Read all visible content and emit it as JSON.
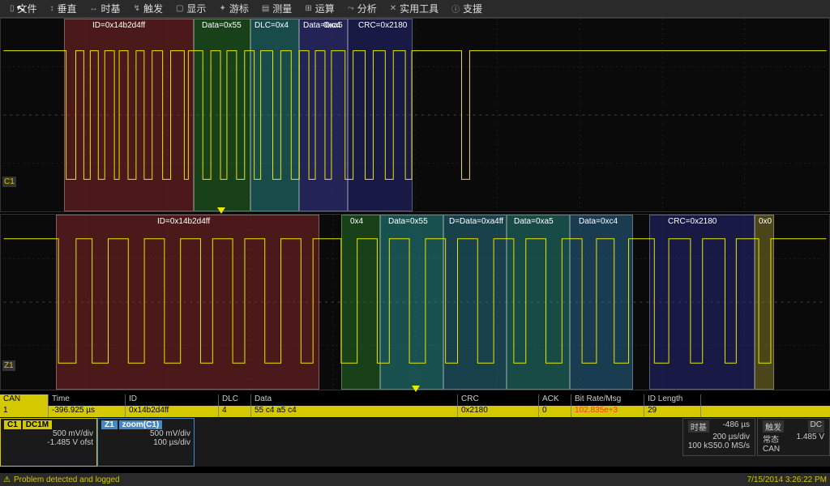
{
  "menu": {
    "file": "文件",
    "vertical": "垂直",
    "timebase": "时基",
    "trigger": "触发",
    "display": "显示",
    "cursors": "游标",
    "measure": "测量",
    "math": "运算",
    "analysis": "分析",
    "utilities": "实用工具",
    "support": "支援"
  },
  "wave1": {
    "ch_label": "C1",
    "decode": {
      "id": "ID=0x14b2d4ff",
      "data1": "Data=0x55",
      "dlc": "DLC=0x4",
      "data2": "Data=0xa5",
      "data3": "0xc4",
      "crc": "CRC=0x2180"
    }
  },
  "wave2": {
    "ch_label": "Z1",
    "decode": {
      "id": "ID=0x14b2d4ff",
      "dlc": "0x4",
      "d1": "Data=0x55",
      "d2": "D=Data=0xa4ff",
      "d3": "Data=0xa5",
      "d4": "Data=0xc4",
      "crc": "CRC=0x2180",
      "ack": "0x0"
    }
  },
  "table": {
    "headers": {
      "protocol": "CAN",
      "time": "Time",
      "id": "ID",
      "dlc": "DLC",
      "data": "Data",
      "crc": "CRC",
      "ack": "ACK",
      "bitrate": "Bit Rate/Msg",
      "idlen": "ID Length"
    },
    "row": {
      "idx": "1",
      "time": "-396.925 µs",
      "id": "0x14b2d4ff",
      "dlc": "4",
      "data": "55 c4 a5 c4",
      "crc": "0x2180",
      "ack": "0",
      "bitrate": "102.835e+3",
      "idlen": "29"
    }
  },
  "channels": {
    "c1": {
      "name": "C1",
      "coupling": "DC1M",
      "vdiv": "500 mV/div",
      "offset": "-1.485 V ofst"
    },
    "z1": {
      "name": "Z1",
      "label": "zoom(C1)",
      "vdiv": "500 mV/div",
      "tdiv": "100 µs/div"
    }
  },
  "rightinfo": {
    "timebase": {
      "label": "时基",
      "delay": "-486 µs",
      "tdiv": "200 µs/div",
      "samples": "100 kS",
      "rate": "50.0 MS/s"
    },
    "trigger": {
      "label": "触发",
      "coupling": "DC",
      "mode": "常态",
      "level": "1.485 V",
      "source": "CAN"
    }
  },
  "status": {
    "msg": "Problem detected and logged",
    "datetime": "7/15/2014 3:26:22 PM"
  }
}
